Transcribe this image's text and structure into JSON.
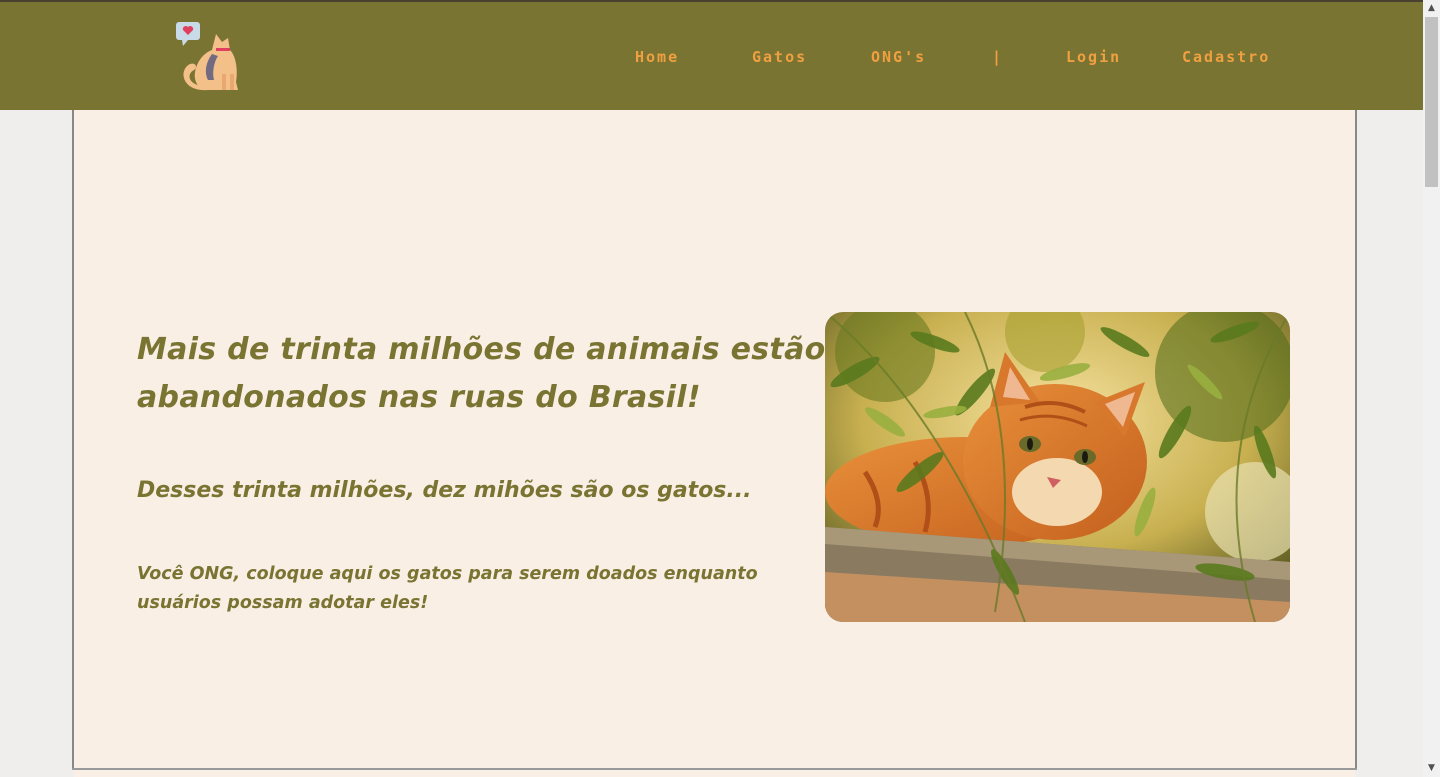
{
  "nav": {
    "logo_icon": "cat-with-heart-bubble-icon",
    "links": [
      {
        "label": "Home"
      },
      {
        "label": "Gatos"
      },
      {
        "label": "ONG's"
      },
      {
        "label": "|"
      },
      {
        "label": "Login"
      },
      {
        "label": "Cadastro"
      }
    ]
  },
  "hero": {
    "headline": "Mais de trinta milhões de animais estão abandonados nas ruas do Brasil!",
    "subheadline": "Desses trinta milhões, dez mihões são os gatos...",
    "body": "Você ONG, coloque aqui os gatos para serem doados enquanto usuários possam adotar eles!",
    "image_subject": "orange-tabby-cat-among-olive-leaves"
  },
  "colors": {
    "navbar_bg": "#7a7432",
    "nav_link": "#f0a040",
    "panel_bg": "#faefe5",
    "text_olive": "#7a7432",
    "page_bg": "#efeeec"
  },
  "scrollbar": {
    "up_arrow": "▲",
    "down_arrow": "▼"
  }
}
